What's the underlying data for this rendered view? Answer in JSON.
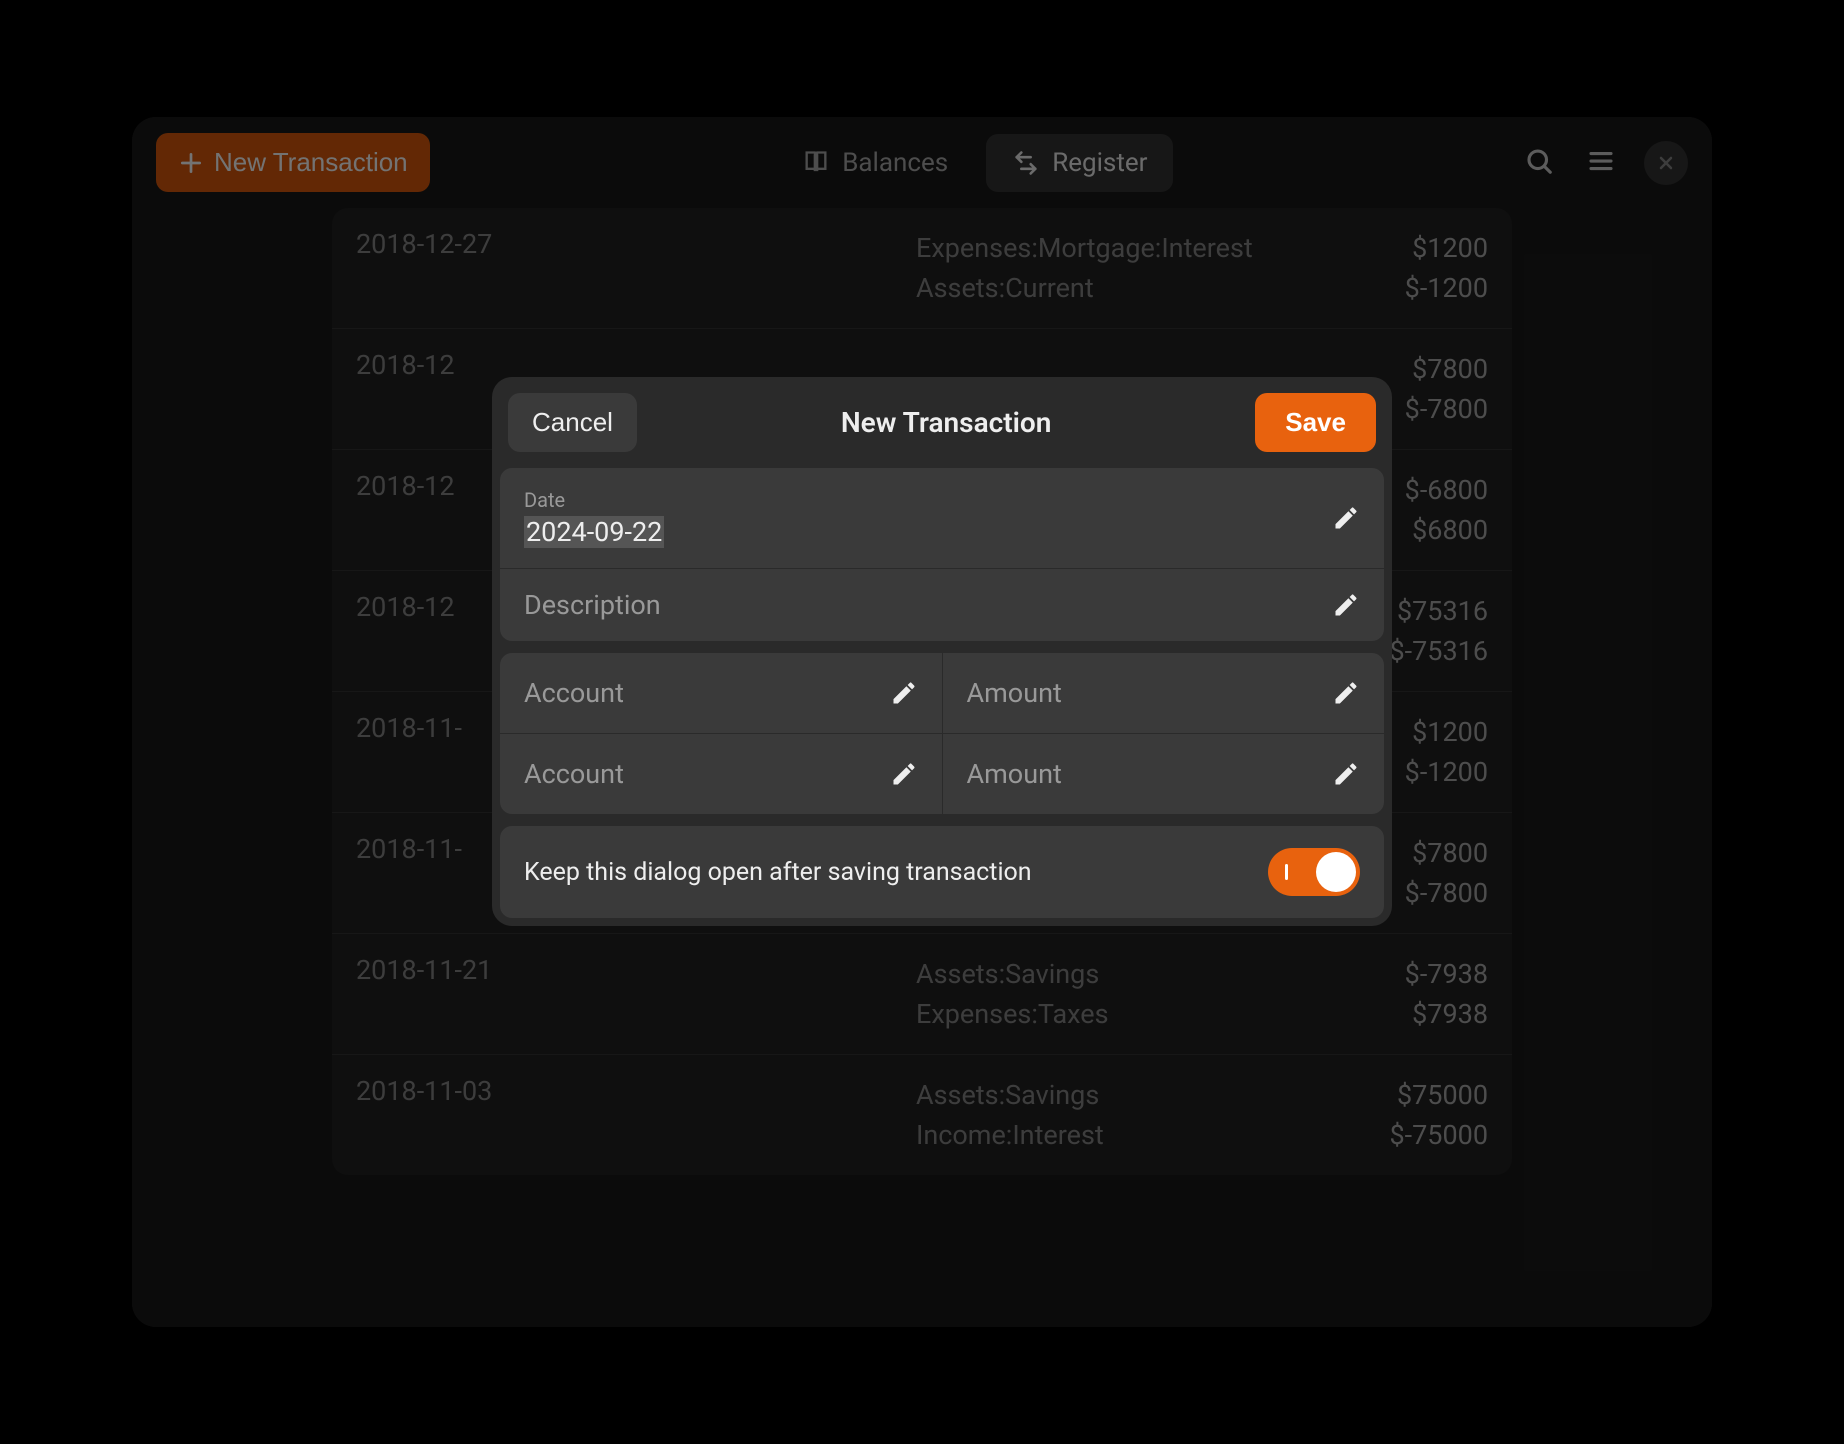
{
  "header": {
    "new_transaction": "New Transaction",
    "balances": "Balances",
    "register": "Register"
  },
  "register": [
    {
      "date": "2018-12-27",
      "lines": [
        {
          "account": "Expenses:Mortgage:Interest",
          "amount": "$1200"
        },
        {
          "account": "Assets:Current",
          "amount": "$-1200"
        }
      ]
    },
    {
      "date": "2018-12",
      "lines": [
        {
          "account": "",
          "amount": "$7800"
        },
        {
          "account": "",
          "amount": "$-7800"
        }
      ]
    },
    {
      "date": "2018-12",
      "lines": [
        {
          "account": "",
          "amount": "$-6800"
        },
        {
          "account": "",
          "amount": "$6800"
        }
      ]
    },
    {
      "date": "2018-12",
      "lines": [
        {
          "account": "",
          "amount": "$75316"
        },
        {
          "account": "",
          "amount": "$-75316"
        }
      ]
    },
    {
      "date": "2018-11-",
      "lines": [
        {
          "account": "",
          "amount": "$1200"
        },
        {
          "account": "",
          "amount": "$-1200"
        }
      ]
    },
    {
      "date": "2018-11-",
      "lines": [
        {
          "account": "",
          "amount": "$7800"
        },
        {
          "account": "",
          "amount": "$-7800"
        }
      ]
    },
    {
      "date": "2018-11-21",
      "lines": [
        {
          "account": "Assets:Savings",
          "amount": "$-7938"
        },
        {
          "account": "Expenses:Taxes",
          "amount": "$7938"
        }
      ]
    },
    {
      "date": "2018-11-03",
      "lines": [
        {
          "account": "Assets:Savings",
          "amount": "$75000"
        },
        {
          "account": "Income:Interest",
          "amount": "$-75000"
        }
      ]
    }
  ],
  "dialog": {
    "cancel": "Cancel",
    "title": "New Transaction",
    "save": "Save",
    "date_label": "Date",
    "date_value": "2024-09-22",
    "description_placeholder": "Description",
    "account_placeholder": "Account",
    "amount_placeholder": "Amount",
    "keep_open_label": "Keep this dialog open after saving transaction",
    "keep_open": true
  }
}
